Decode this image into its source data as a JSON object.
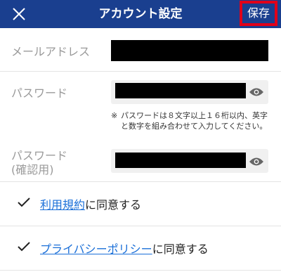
{
  "header": {
    "title": "アカウント設定",
    "save_label": "保存",
    "close_icon": "close-icon",
    "background_color": "#1a3f8f"
  },
  "form": {
    "email_label": "メールアドレス",
    "password_label": "パスワード",
    "password_note_mark": "※",
    "password_note": "パスワードは８文字以上１６桁以内、英字と数字を組み合わせて入力してください。",
    "confirm_label_line1": "パスワード",
    "confirm_label_line2": "(確認用)"
  },
  "agreements": [
    {
      "link_text": "利用規約",
      "suffix": "に同意する",
      "checked": true
    },
    {
      "link_text": "プライバシーポリシー",
      "suffix": "に同意する",
      "checked": true
    }
  ],
  "colors": {
    "link": "#1a6fd8",
    "highlight_border": "#e0001a"
  }
}
